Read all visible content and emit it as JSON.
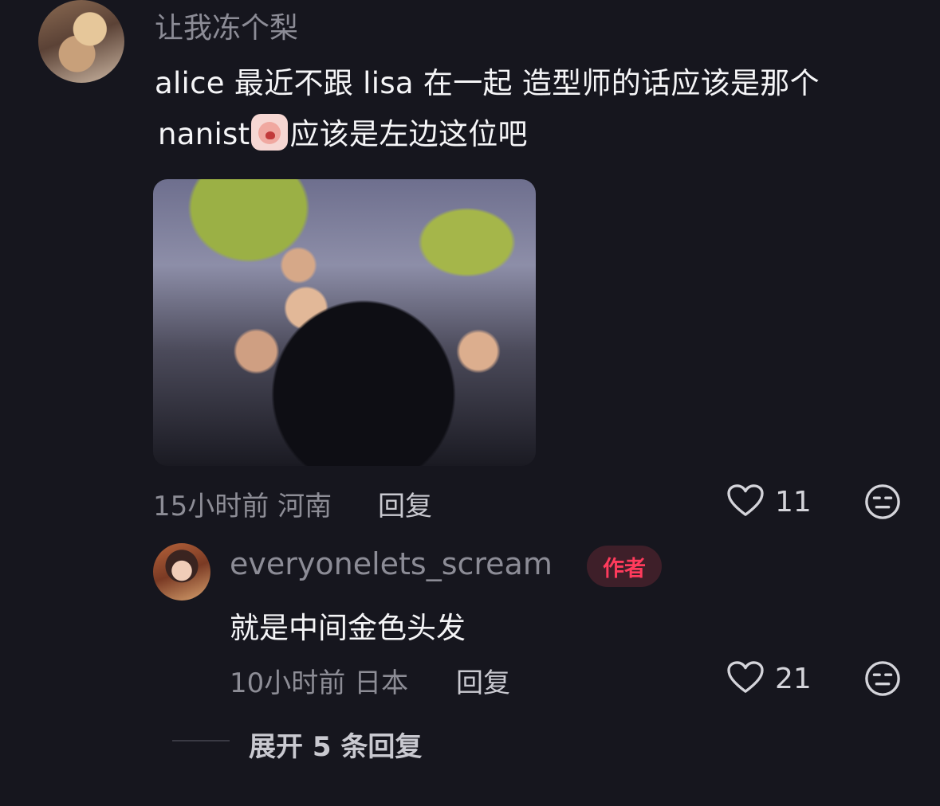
{
  "comment": {
    "username": "让我冻个梨",
    "text_line1": "alice 最近不跟 lisa 在一起 造型师的话应该是那个",
    "text_line2_before": "nanist",
    "emoji_icon": "crying-face-sticker-icon",
    "text_line2_after": "应该是左边这位吧",
    "time_location": "15小时前 河南",
    "reply_label": "回复",
    "likes": "11"
  },
  "reply": {
    "username": "everyonelets_scream",
    "badge": "作者",
    "text": "就是中间金色头发",
    "time_location": "10小时前 日本",
    "reply_label": "回复",
    "likes": "21"
  },
  "thread": {
    "expand_label": "展开 5 条回复"
  },
  "colors": {
    "background": "#16161e",
    "badge_text": "#ff3b5c",
    "badge_bg": "#3e1f29"
  }
}
